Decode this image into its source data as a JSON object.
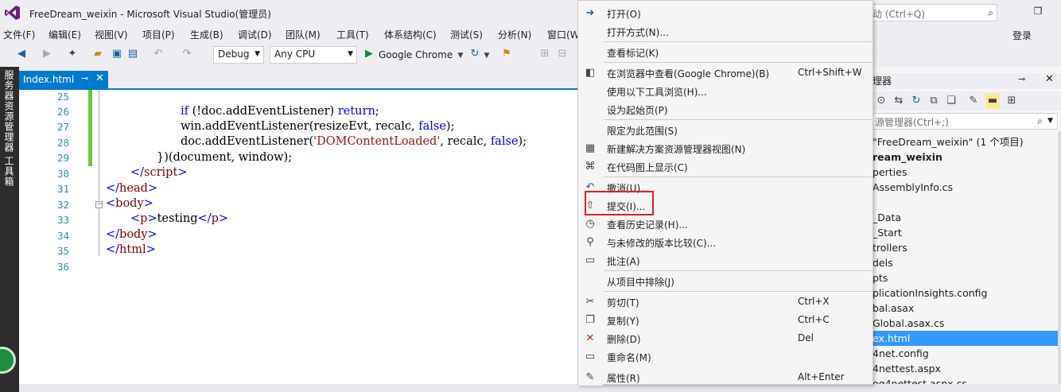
{
  "window": {
    "title": "FreeDream_weixin - Microsoft Visual Studio(管理员)",
    "quick_launch_placeholder": "动 (Ctrl+Q)",
    "login": "登录"
  },
  "menu": [
    "文件(F)",
    "编辑(E)",
    "视图(V)",
    "项目(P)",
    "生成(B)",
    "调试(D)",
    "团队(M)",
    "工具(T)",
    "体系结构(C)",
    "测试(S)",
    "分析(N)",
    "窗口(W"
  ],
  "toolbar": {
    "config": "Debug",
    "platform": "Any CPU",
    "browser": "Google Chrome"
  },
  "left_tabs": [
    "服务器资源管理器",
    "工具箱"
  ],
  "editor": {
    "tab_label": "Index.html",
    "line_numbers": [
      "25",
      "26",
      "27",
      "28",
      "29",
      "30",
      "31",
      "32",
      "33",
      "34",
      "35",
      "36"
    ],
    "lines": {
      "l26a": "if",
      "l26b": " (!doc.addEventListener) ",
      "l26c": "return",
      "l26d": ";",
      "l27a": "win.addEventListener(resizeEvt, recalc, ",
      "l27b": "false",
      "l27c": ");",
      "l28a": "doc.addEventListener(",
      "l28b": "'DOMContentLoaded'",
      "l28c": ", recalc, ",
      "l28d": "false",
      "l28e": ");",
      "l29": "})(document, window);",
      "l30a": "</",
      "l30b": "script",
      "l30c": ">",
      "l31a": "</",
      "l31b": "head",
      "l31c": ">",
      "l32a": "<",
      "l32b": "body",
      "l32c": ">",
      "l33a": "<",
      "l33b": "p",
      "l33c": ">",
      "l33d": "testing",
      "l33e": "</",
      "l33f": "p",
      "l33g": ">",
      "l34a": "</",
      "l34b": "body",
      "l34c": ">",
      "l35a": "</",
      "l35b": "html",
      "l35c": ">"
    }
  },
  "context_menu": [
    {
      "label": "打开(O)",
      "shortcut": "",
      "icon": "open-icon"
    },
    {
      "label": "打开方式(N)...",
      "shortcut": "",
      "icon": ""
    },
    {
      "label": "查看标记(K)",
      "shortcut": "",
      "icon": ""
    },
    {
      "label": "在浏览器中查看(Google Chrome)(B)",
      "shortcut": "Ctrl+Shift+W",
      "icon": "browser-icon"
    },
    {
      "label": "使用以下工具浏览(H)...",
      "shortcut": "",
      "icon": ""
    },
    {
      "label": "设为起始页(P)",
      "shortcut": "",
      "icon": ""
    },
    {
      "label": "限定为此范围(S)",
      "shortcut": "",
      "icon": ""
    },
    {
      "label": "新建解决方案资源管理器视图(N)",
      "shortcut": "",
      "icon": "new-view-icon"
    },
    {
      "label": "在代码图上显示(C)",
      "shortcut": "",
      "icon": "code-map-icon"
    },
    {
      "label": "撤消(U)...",
      "shortcut": "",
      "icon": "undo-icon"
    },
    {
      "label": "提交(I)...",
      "shortcut": "",
      "icon": "commit-icon"
    },
    {
      "label": "查看历史记录(H)...",
      "shortcut": "",
      "icon": "history-icon"
    },
    {
      "label": "与未修改的版本比较(C)...",
      "shortcut": "",
      "icon": "compare-icon"
    },
    {
      "label": "批注(A)",
      "shortcut": "",
      "icon": "annotate-icon"
    },
    {
      "label": "从项目中排除(J)",
      "shortcut": "",
      "icon": ""
    },
    {
      "label": "剪切(T)",
      "shortcut": "Ctrl+X",
      "icon": "cut-icon"
    },
    {
      "label": "复制(Y)",
      "shortcut": "Ctrl+C",
      "icon": "copy-icon"
    },
    {
      "label": "删除(D)",
      "shortcut": "Del",
      "icon": "delete-icon"
    },
    {
      "label": "重命名(M)",
      "shortcut": "",
      "icon": "rename-icon"
    },
    {
      "label": "属性(R)",
      "shortcut": "Alt+Enter",
      "icon": "properties-icon"
    }
  ],
  "solution_explorer": {
    "title": "理器",
    "search_placeholder": "源管理器(Ctrl+;)",
    "items": [
      "\"FreeDream_weixin\" (1 个项目)",
      "ream_weixin",
      "perties",
      "AssemblyInfo.cs",
      "",
      "_Data",
      "_Start",
      "trollers",
      "dels",
      "pts",
      "plicationInsights.config",
      "bal.asax",
      "Global.asax.cs",
      "ex.html",
      "4net.config",
      "4nettest.aspx",
      "og4nettest.aspx.cs"
    ],
    "selected_index": 13
  },
  "colors": {
    "accent": "#007acc",
    "highlight_box": "#e52020",
    "selection": "#3399ff"
  }
}
